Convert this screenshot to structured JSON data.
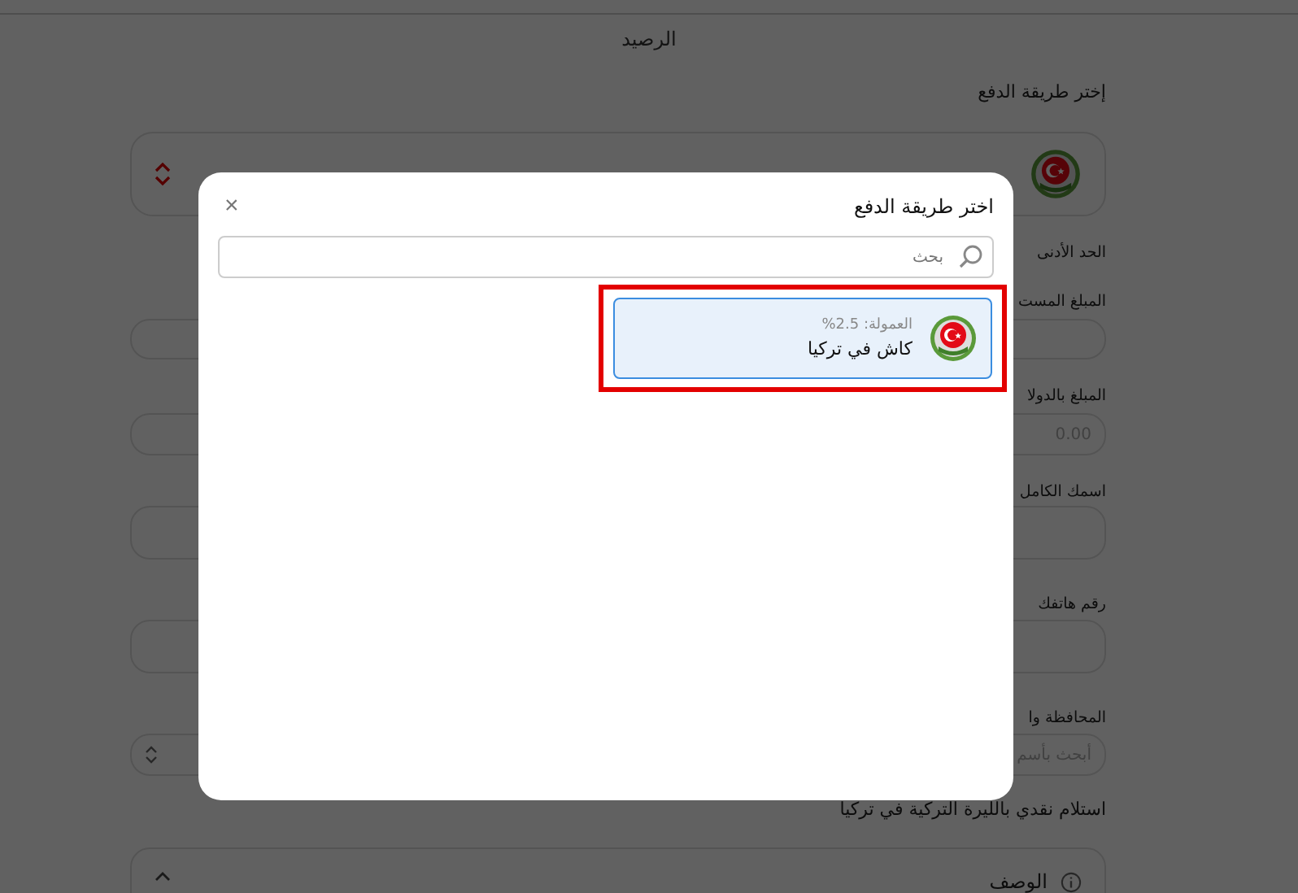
{
  "page": {
    "title": "الرصيد",
    "method_label": "إختر طريقة الدفع",
    "min_label": "الحد الأدنى",
    "fields": [
      {
        "label": "المبلغ المست",
        "kind": "compact"
      },
      {
        "label": "المبلغ بالدولا",
        "kind": "compact",
        "placeholder": "0.00"
      },
      {
        "label": "اسمك الكامل",
        "kind": "large"
      },
      {
        "label": "رقم هاتفك",
        "kind": "large"
      },
      {
        "label": "المحافظة وا",
        "kind": "select",
        "placeholder": "أبحث بأسم"
      }
    ],
    "method_title": "استلام نقدي بالليرة التركية في تركيا",
    "accordion": {
      "title": "الوصف",
      "expanded": true
    }
  },
  "modal": {
    "title": "اختر طريقة الدفع",
    "close": "×",
    "search": {
      "placeholder": "بحث"
    },
    "methods": [
      {
        "fee": "العمولة: 2.5%",
        "name": "كاش في تركيا",
        "selected": true,
        "highlighted": true
      }
    ]
  }
}
